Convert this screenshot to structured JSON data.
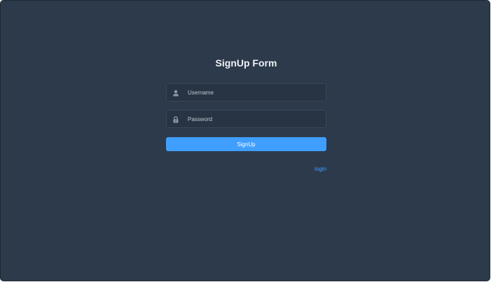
{
  "form": {
    "title": "SignUp Form",
    "username": {
      "placeholder": "Username",
      "value": "",
      "icon": "user-icon"
    },
    "password": {
      "placeholder": "Password",
      "value": "",
      "icon": "lock-icon"
    },
    "submit_label": "SignUp",
    "login_link": "login"
  },
  "colors": {
    "background": "#2d3a4b",
    "input_background": "#283443",
    "accent": "#409eff",
    "title_text": "#eef1f5"
  }
}
